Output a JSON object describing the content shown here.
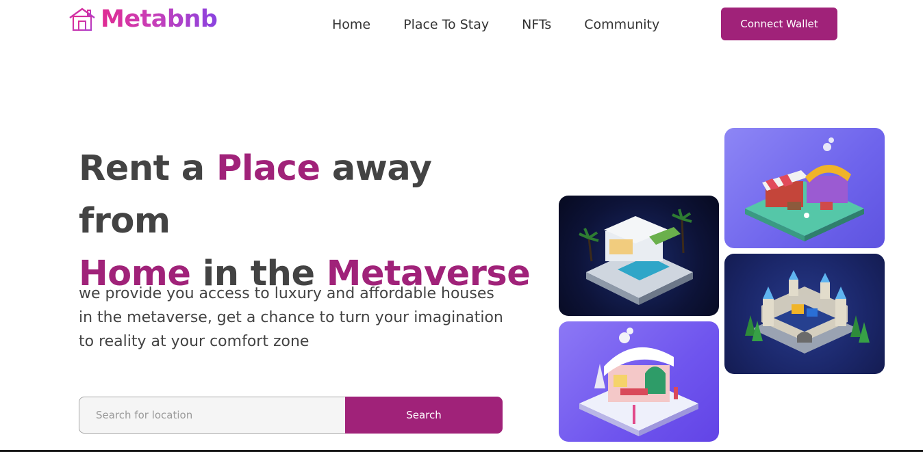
{
  "brand": {
    "name": "Metabnb",
    "icon": "house-icon",
    "gradient": [
      "#e02b92",
      "#8a43e0"
    ]
  },
  "nav": {
    "items": [
      {
        "label": "Home"
      },
      {
        "label": "Place To Stay"
      },
      {
        "label": "NFTs"
      },
      {
        "label": "Community"
      }
    ],
    "connect_label": "Connect Wallet"
  },
  "hero": {
    "title_part1": "Rent a ",
    "title_accent1": "Place",
    "title_part2": " away from",
    "title_accent2": "Home",
    "title_part3": " in the ",
    "title_accent3": "Metaverse",
    "description": "we provide you access to luxury and affordable houses in the metaverse, get a chance to turn your imagination to reality at your comfort zone"
  },
  "search": {
    "placeholder": "Search for location",
    "value": "",
    "button_label": "Search"
  },
  "gallery": [
    {
      "name": "market-stall-image"
    },
    {
      "name": "modern-villa-image"
    },
    {
      "name": "castle-image"
    },
    {
      "name": "snow-cottage-image"
    }
  ],
  "colors": {
    "accent": "#a02279",
    "text": "#434343"
  }
}
